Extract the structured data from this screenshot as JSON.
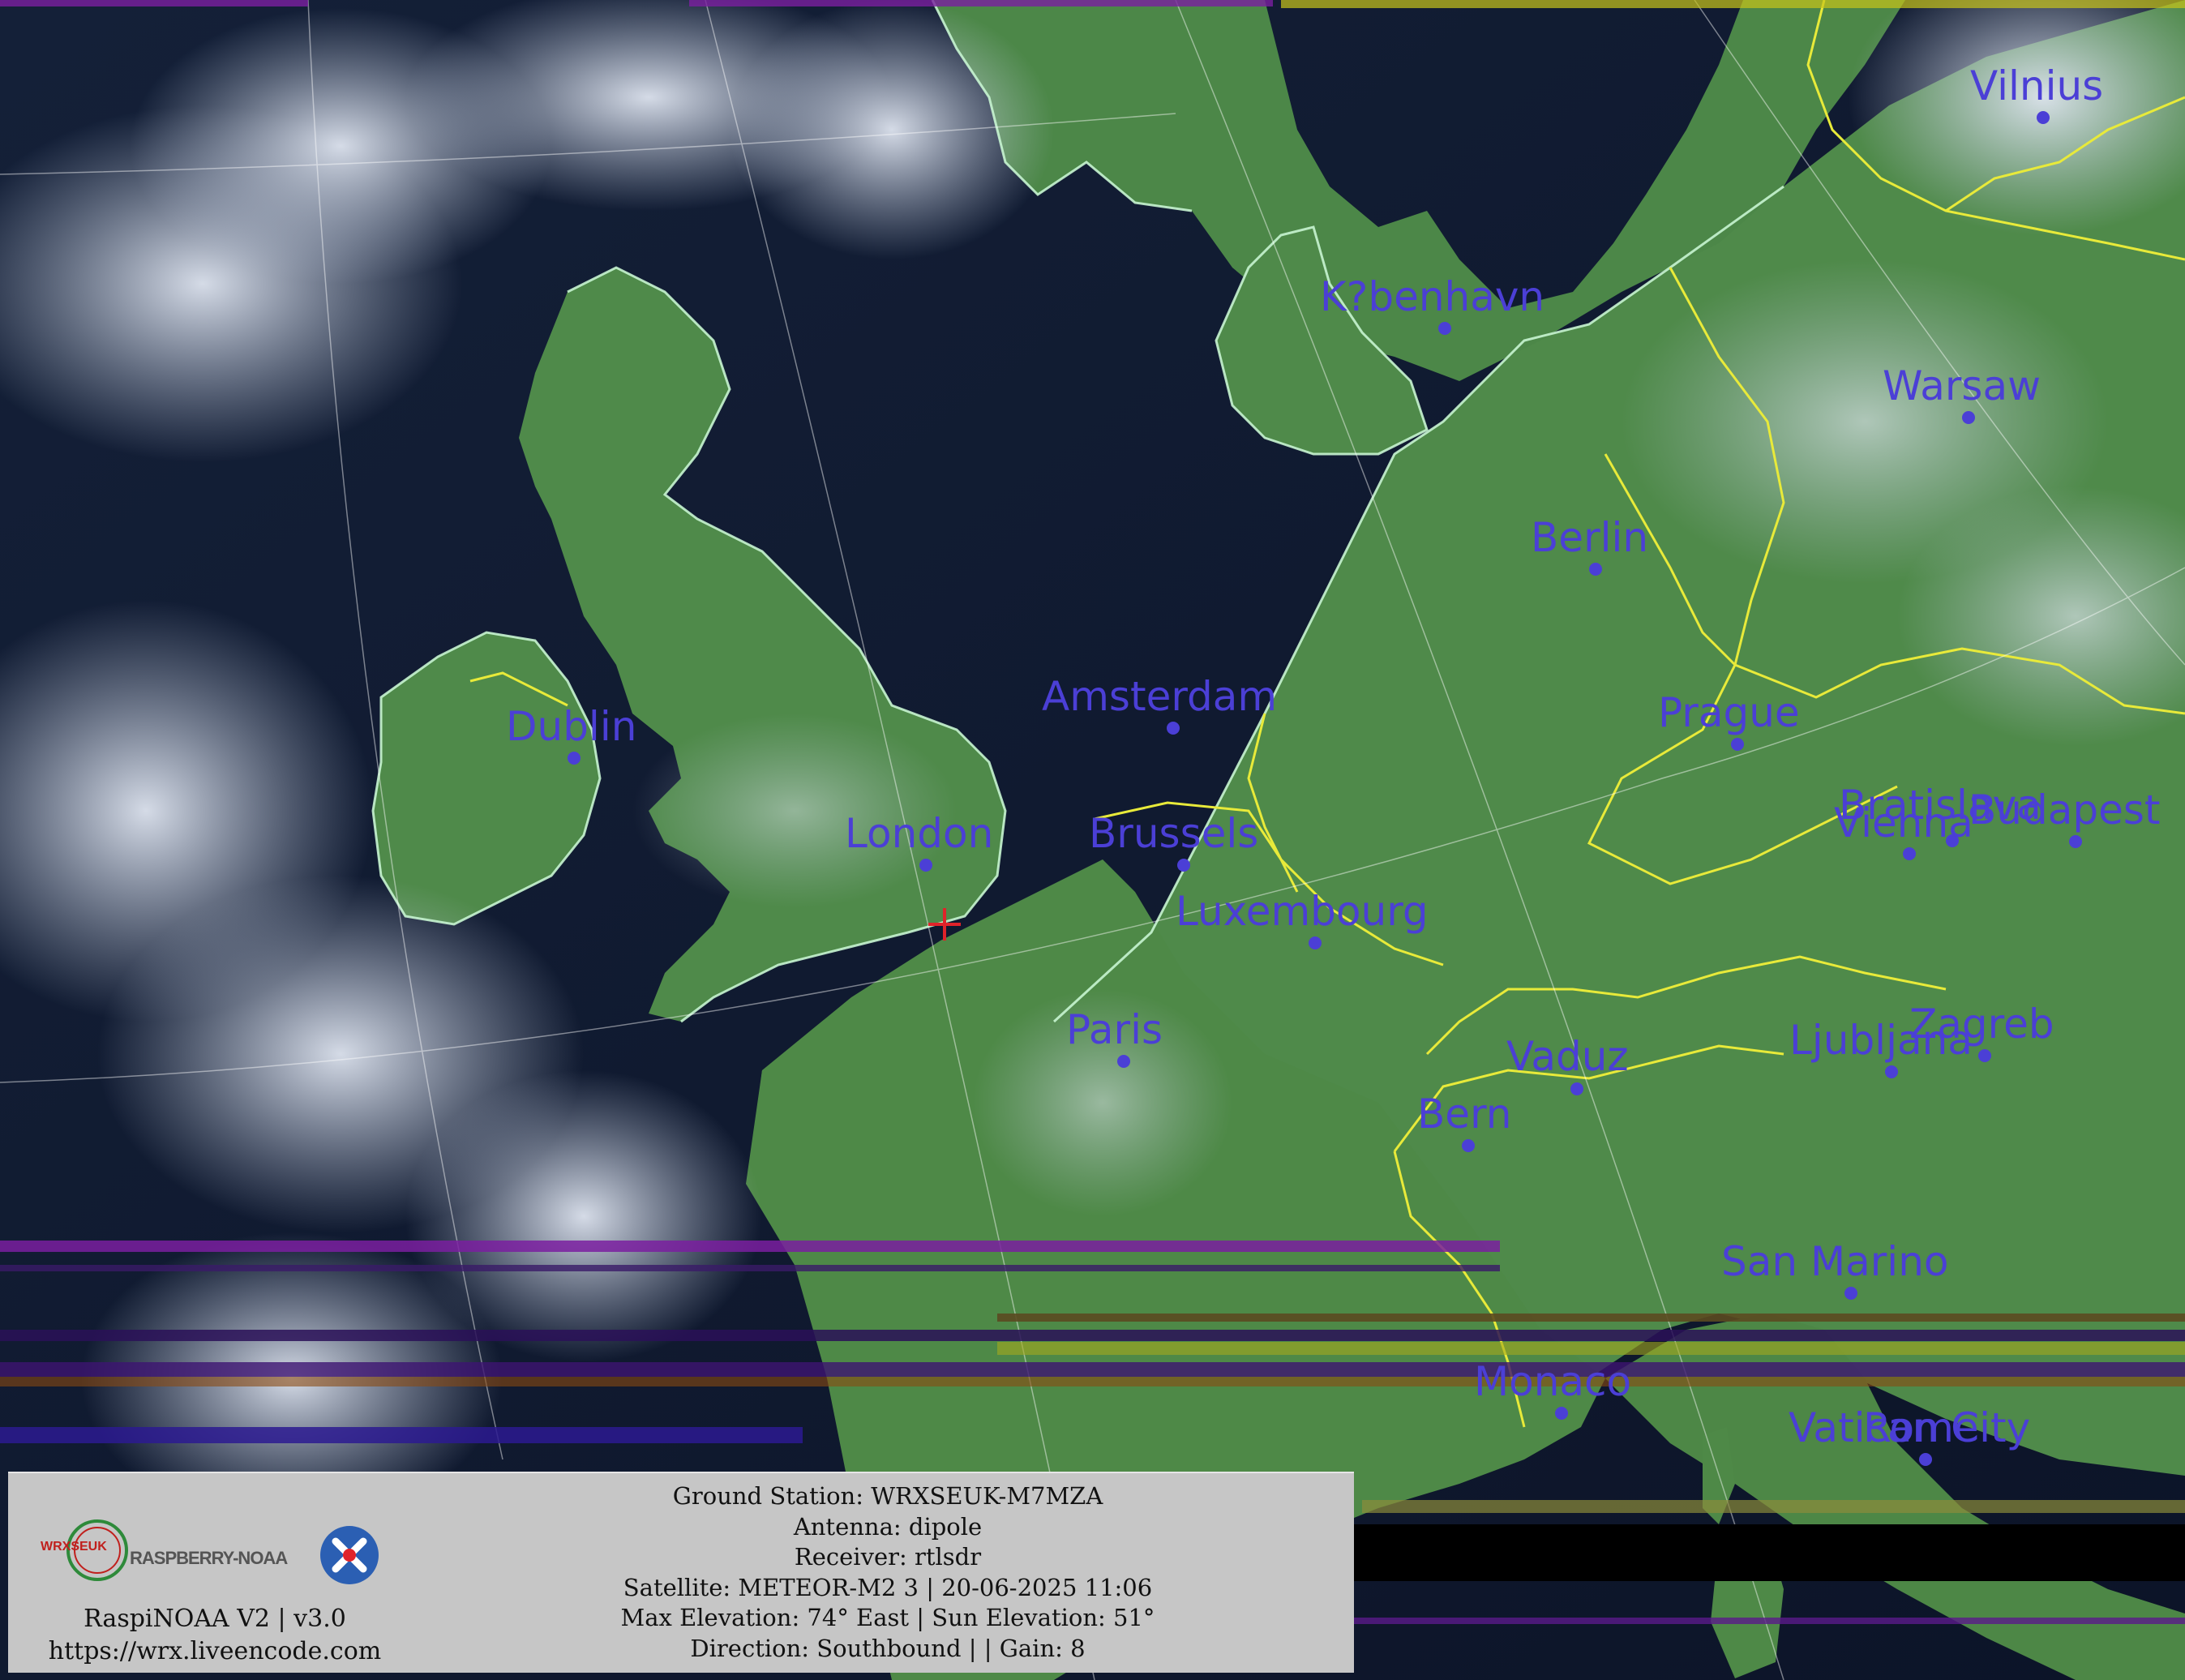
{
  "map": {
    "colors": {
      "ocean": "#0f1a33",
      "land": "#4f8a4a",
      "cloud": "#c9d3e3",
      "coastline": "#c8f5d2",
      "border": "#e8ea3a",
      "city": "#4b3fd6",
      "station_marker": "#e0232a"
    },
    "ground_station_marker_icon": "crosshair-plus-icon",
    "cities": [
      {
        "name": "Vilnius"
      },
      {
        "name": "K?benhavn"
      },
      {
        "name": "Warsaw"
      },
      {
        "name": "Berlin"
      },
      {
        "name": "Amsterdam"
      },
      {
        "name": "Prague"
      },
      {
        "name": "Dublin"
      },
      {
        "name": "London"
      },
      {
        "name": "Brussels"
      },
      {
        "name": "Bratislava"
      },
      {
        "name": "Vienna"
      },
      {
        "name": "Budapest"
      },
      {
        "name": "Luxembourg"
      },
      {
        "name": "Paris"
      },
      {
        "name": "Zagreb"
      },
      {
        "name": "Ljubljana"
      },
      {
        "name": "Vaduz"
      },
      {
        "name": "Bern"
      },
      {
        "name": "San Marino"
      },
      {
        "name": "Monaco"
      },
      {
        "name": "Vatican City"
      },
      {
        "name": "Rome"
      }
    ]
  },
  "info": {
    "logo": {
      "wrxseuk_text": "WRXSEUK",
      "brand_text": "RASPBERRY-NOAA",
      "icon": "satellite-x-icon"
    },
    "brand_line": "RaspiNOAA V2 | v3.0",
    "url": "https://wrx.liveencode.com",
    "details": [
      "Ground Station: WRXSEUK-M7MZA",
      "Antenna: dipole",
      "Receiver: rtlsdr",
      "Satellite: METEOR-M2 3 | 20-06-2025 11:06",
      "Max Elevation: 74° East | Sun Elevation: 51°",
      "Direction: Southbound | | Gain: 8"
    ]
  }
}
